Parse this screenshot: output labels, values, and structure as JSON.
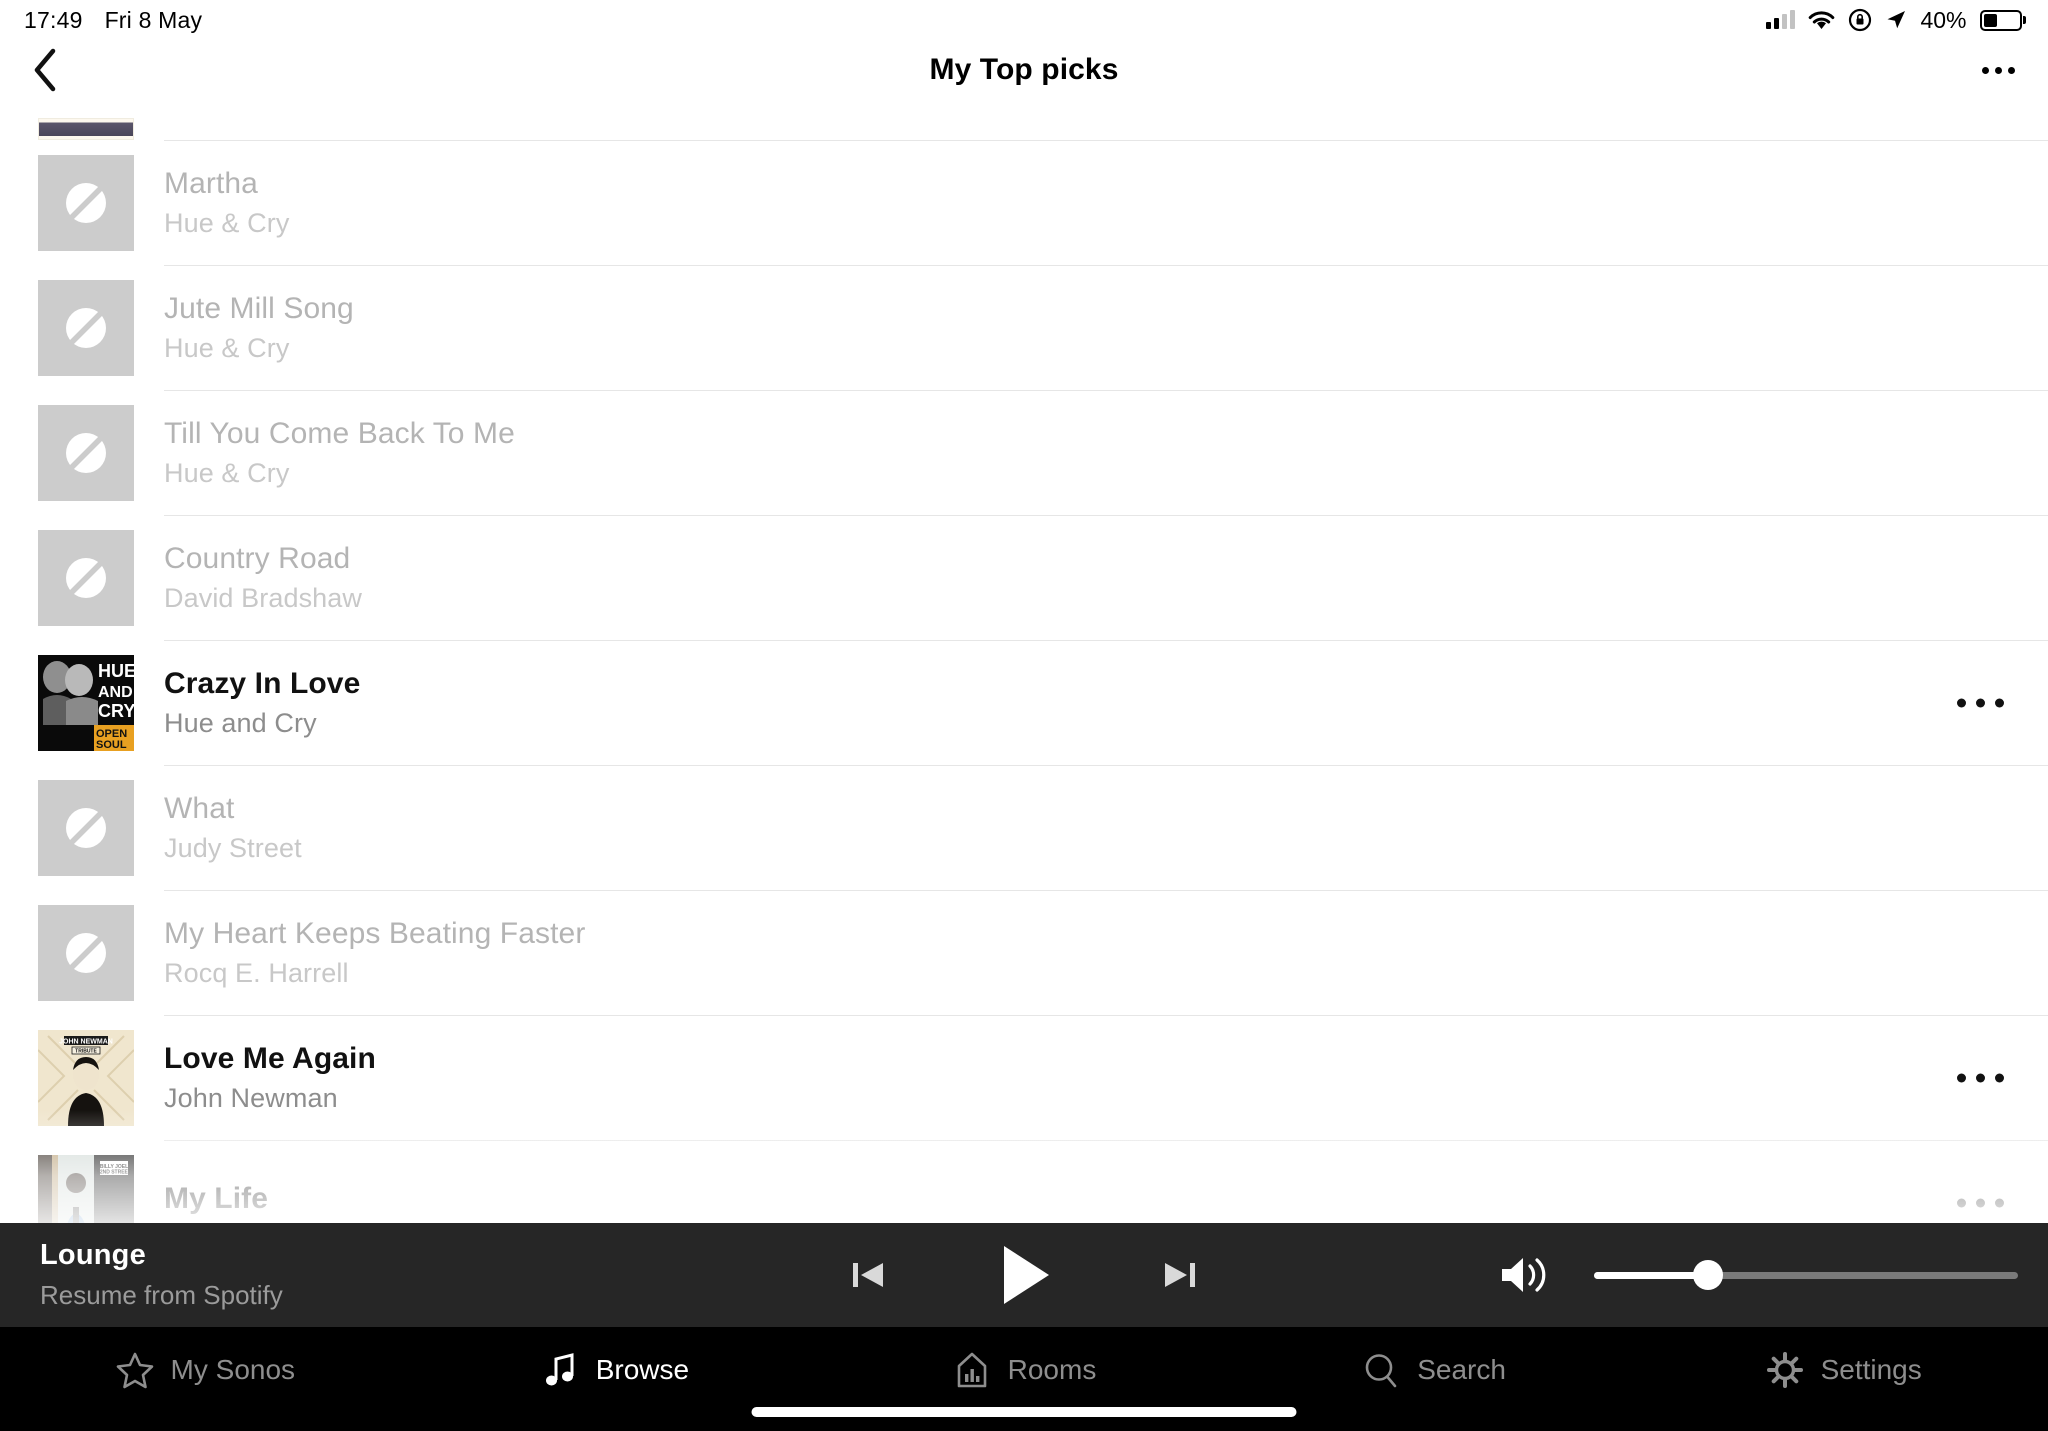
{
  "status_bar": {
    "time": "17:49",
    "date": "Fri 8 May",
    "battery_percent": "40%",
    "icons": [
      "cellular-signal-icon",
      "wifi-icon",
      "rotation-lock-icon",
      "location-arrow-icon",
      "battery-icon"
    ]
  },
  "header": {
    "title": "My Top picks",
    "back_icon": "chevron-left-icon",
    "more_icon": "overflow-menu-icon"
  },
  "list": {
    "partial_top_row": {
      "title": "",
      "artist": ""
    },
    "tracks": [
      {
        "title": "Martha",
        "artist": "Hue & Cry",
        "artwork": "placeholder",
        "active": false,
        "has_more": false
      },
      {
        "title": "Jute Mill Song",
        "artist": "Hue & Cry",
        "artwork": "placeholder",
        "active": false,
        "has_more": false
      },
      {
        "title": "Till You Come Back To Me",
        "artist": "Hue & Cry",
        "artwork": "placeholder",
        "active": false,
        "has_more": false
      },
      {
        "title": "Country Road",
        "artist": "David Bradshaw",
        "artwork": "placeholder",
        "active": false,
        "has_more": false
      },
      {
        "title": "Crazy In Love",
        "artist": "Hue and Cry",
        "artwork": "hue-and-cry-open-soul",
        "active": true,
        "has_more": true
      },
      {
        "title": "What",
        "artist": "Judy Street",
        "artwork": "placeholder",
        "active": false,
        "has_more": false
      },
      {
        "title": "My Heart Keeps Beating Faster",
        "artist": "Rocq E. Harrell",
        "artwork": "placeholder",
        "active": false,
        "has_more": false
      },
      {
        "title": "Love Me Again",
        "artist": "John Newman",
        "artwork": "john-newman-tribute",
        "active": true,
        "has_more": true
      },
      {
        "title": "My Life",
        "artist": "",
        "artwork": "billy-joel",
        "active": true,
        "has_more": true
      }
    ]
  },
  "now_playing": {
    "room": "Lounge",
    "subtitle": "Resume from Spotify",
    "previous_icon": "skip-previous-icon",
    "play_icon": "play-icon",
    "next_icon": "skip-next-icon",
    "volume_icon": "speaker-volume-icon",
    "volume_level": 27
  },
  "tab_bar": {
    "tabs": [
      {
        "label": "My Sonos",
        "icon": "star-icon",
        "active": false
      },
      {
        "label": "Browse",
        "icon": "music-note-icon",
        "active": true
      },
      {
        "label": "Rooms",
        "icon": "rooms-house-icon",
        "active": false
      },
      {
        "label": "Search",
        "icon": "search-icon",
        "active": false
      },
      {
        "label": "Settings",
        "icon": "gear-icon",
        "active": false
      }
    ]
  },
  "colors": {
    "now_playing_bg": "#262626",
    "tab_bar_bg": "#000000",
    "inactive_text": "#b4b4b4",
    "active_text": "#111111"
  }
}
